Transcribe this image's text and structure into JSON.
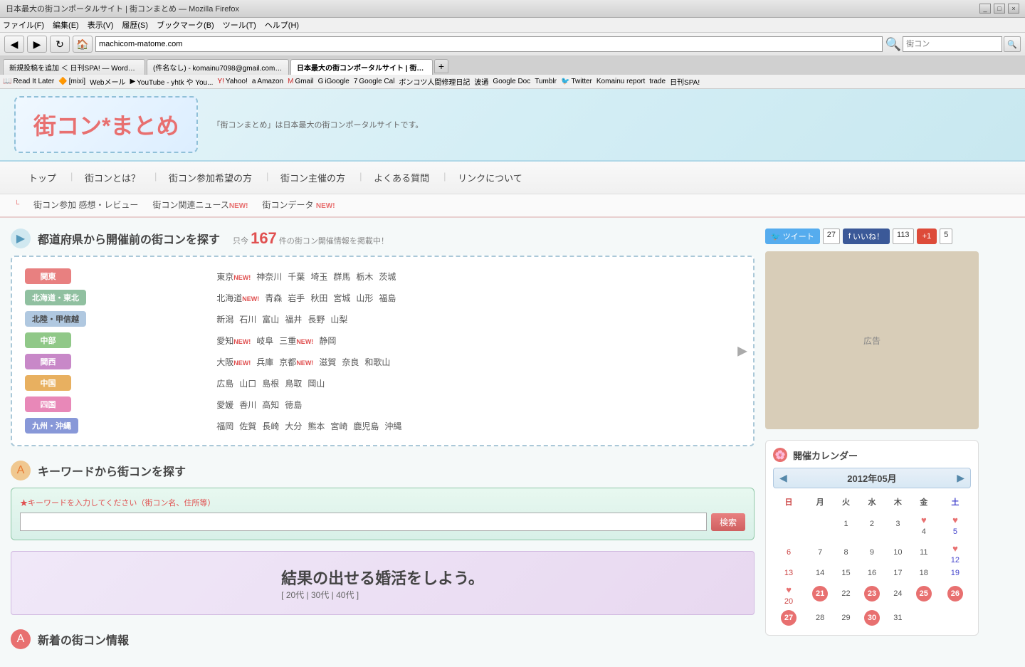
{
  "browser": {
    "title": "日本最大の街コンポータルサイト | 街コンまとめ — Mozilla Firefox",
    "controls": [
      "_",
      "□",
      "×"
    ],
    "menu": [
      "ファイル(F)",
      "編集(E)",
      "表示(V)",
      "履歴(S)",
      "ブックマーク(B)",
      "ツール(T)",
      "ヘルプ(H)"
    ],
    "tabs": [
      {
        "label": "新規投稿を追加 ＜ 日刊SPA! — WordPr...",
        "active": false
      },
      {
        "label": "(件名なし) - komainu7098@gmail.com -...",
        "active": false
      },
      {
        "label": "日本最大の街コンポータルサイト | 街コン...",
        "active": true
      }
    ],
    "address": "machicom-matome.com",
    "search_placeholder": "街コン",
    "bookmarks": [
      {
        "icon": "📖",
        "label": "Read It Later"
      },
      {
        "icon": "🔶",
        "label": "[mixi]"
      },
      {
        "icon": "📄",
        "label": "Webメール"
      },
      {
        "icon": "▶",
        "label": "YouTube - yhtk や You..."
      },
      {
        "icon": "🔴",
        "label": "Yahoo!"
      },
      {
        "icon": "a",
        "label": "Amazon"
      },
      {
        "icon": "M",
        "label": "Gmail"
      },
      {
        "icon": "G",
        "label": "iGoogle"
      },
      {
        "icon": "7",
        "label": "Google Cal"
      },
      {
        "icon": "🐾",
        "label": "ボンコツ人間修理日記"
      },
      {
        "icon": "📡",
        "label": "波通"
      },
      {
        "icon": "G",
        "label": "Google Doc"
      },
      {
        "icon": "T",
        "label": "Tumblr"
      },
      {
        "icon": "🐦",
        "label": "Twitter"
      },
      {
        "icon": "K",
        "label": "Komainu report"
      },
      {
        "icon": "📁",
        "label": "trade"
      },
      {
        "icon": "📰",
        "label": "日刊SPA!"
      }
    ]
  },
  "site": {
    "logo_text": "街コン*まとめ",
    "tagline": "「街コンまとめ」は日本最大の街コンポータルサイトです。",
    "nav": [
      "トップ",
      "街コンとは？",
      "街コン参加希望の方",
      "街コン主催の方",
      "よくある質問",
      "リンクについて"
    ],
    "subnav": [
      {
        "label": "街コン参加 感想・レビュー",
        "new": false
      },
      {
        "label": "街コン関連ニュース",
        "new": true
      },
      {
        "label": "街コンデータ",
        "new": true
      }
    ]
  },
  "pref_section": {
    "heading": "都道府県から開催前の街コンを探す",
    "count_prefix": "只今",
    "count": "167",
    "count_suffix": "件の街コン開催情報を掲載中！",
    "regions": [
      {
        "name": "関東",
        "class": "kanto",
        "prefs": [
          {
            "label": "東京",
            "new": true
          },
          {
            "label": "神奈川",
            "new": false
          },
          {
            "label": "千葉",
            "new": false
          },
          {
            "label": "埼玉",
            "new": false
          },
          {
            "label": "群馬",
            "new": false
          },
          {
            "label": "栃木",
            "new": false
          },
          {
            "label": "茨城",
            "new": false
          }
        ]
      },
      {
        "name": "北海道・東北",
        "class": "hokkaido",
        "prefs": [
          {
            "label": "北海道",
            "new": true
          },
          {
            "label": "青森",
            "new": false
          },
          {
            "label": "岩手",
            "new": false
          },
          {
            "label": "秋田",
            "new": false
          },
          {
            "label": "宮城",
            "new": false
          },
          {
            "label": "山形",
            "new": false
          },
          {
            "label": "福島",
            "new": false
          }
        ]
      },
      {
        "name": "北陸・甲信越",
        "class": "hokuriku",
        "prefs": [
          {
            "label": "新潟",
            "new": false
          },
          {
            "label": "石川",
            "new": false
          },
          {
            "label": "富山",
            "new": false
          },
          {
            "label": "福井",
            "new": false
          },
          {
            "label": "長野",
            "new": false
          },
          {
            "label": "山梨",
            "new": false
          }
        ]
      },
      {
        "name": "中部",
        "class": "chubu",
        "prefs": [
          {
            "label": "愛知",
            "new": true
          },
          {
            "label": "岐阜",
            "new": false
          },
          {
            "label": "三重",
            "new": true
          },
          {
            "label": "静岡",
            "new": false
          }
        ]
      },
      {
        "name": "関西",
        "class": "kansai",
        "prefs": [
          {
            "label": "大阪",
            "new": true
          },
          {
            "label": "兵庫",
            "new": false
          },
          {
            "label": "京都",
            "new": true
          },
          {
            "label": "滋賀",
            "new": false
          },
          {
            "label": "奈良",
            "new": false
          },
          {
            "label": "和歌山",
            "new": false
          }
        ]
      },
      {
        "name": "中国",
        "class": "chugoku",
        "prefs": [
          {
            "label": "広島",
            "new": false
          },
          {
            "label": "山口",
            "new": false
          },
          {
            "label": "島根",
            "new": false
          },
          {
            "label": "鳥取",
            "new": false
          },
          {
            "label": "岡山",
            "new": false
          }
        ]
      },
      {
        "name": "四国",
        "class": "shikoku",
        "prefs": [
          {
            "label": "愛媛",
            "new": false
          },
          {
            "label": "香川",
            "new": false
          },
          {
            "label": "高知",
            "new": false
          },
          {
            "label": "徳島",
            "new": false
          }
        ]
      },
      {
        "name": "九州・沖縄",
        "class": "kyushu",
        "prefs": [
          {
            "label": "福岡",
            "new": false
          },
          {
            "label": "佐賀",
            "new": false
          },
          {
            "label": "長崎",
            "new": false
          },
          {
            "label": "大分",
            "new": false
          },
          {
            "label": "熊本",
            "new": false
          },
          {
            "label": "宮崎",
            "new": false
          },
          {
            "label": "鹿児島",
            "new": false
          },
          {
            "label": "沖縄",
            "new": false
          }
        ]
      }
    ]
  },
  "keyword_section": {
    "heading": "キーワードから街コンを探す",
    "label": "★キーワードを入力してください（街コン名、住所等）",
    "placeholder": "",
    "search_btn": "検索"
  },
  "ad_banner": {
    "main_text": "結果の出せる婚活をしよう。",
    "sub_text": "[ 20代 | 30代 | 40代 ]"
  },
  "new_events": {
    "heading": "新着の街コン情報"
  },
  "social": {
    "tweet_label": "ツイート",
    "tweet_count": "27",
    "like_label": "いいね！",
    "like_count": "113",
    "gplus_label": "+1",
    "gplus_count": "5"
  },
  "calendar": {
    "heading": "開催カレンダー",
    "year_month": "2012年05月",
    "days_of_week": [
      "日",
      "月",
      "火",
      "水",
      "木",
      "金",
      "土"
    ],
    "weeks": [
      [
        "",
        "",
        "1",
        "2",
        "3",
        "4",
        "5"
      ],
      [
        "6",
        "7",
        "8",
        "9",
        "10",
        "11",
        "12"
      ],
      [
        "13",
        "14",
        "15",
        "16",
        "17",
        "18",
        "19"
      ],
      [
        "20",
        "21",
        "22",
        "23",
        "24",
        "25",
        "26"
      ],
      [
        "27",
        "28",
        "29",
        "30",
        "31",
        "",
        ""
      ]
    ],
    "event_days": [
      "4",
      "5",
      "12",
      "20",
      "21",
      "23",
      "25",
      "26",
      "27",
      "30"
    ],
    "highlighted_days": [
      "21",
      "23",
      "25",
      "26",
      "27",
      "30"
    ],
    "heart_days": [
      "4",
      "5",
      "12",
      "20"
    ]
  }
}
